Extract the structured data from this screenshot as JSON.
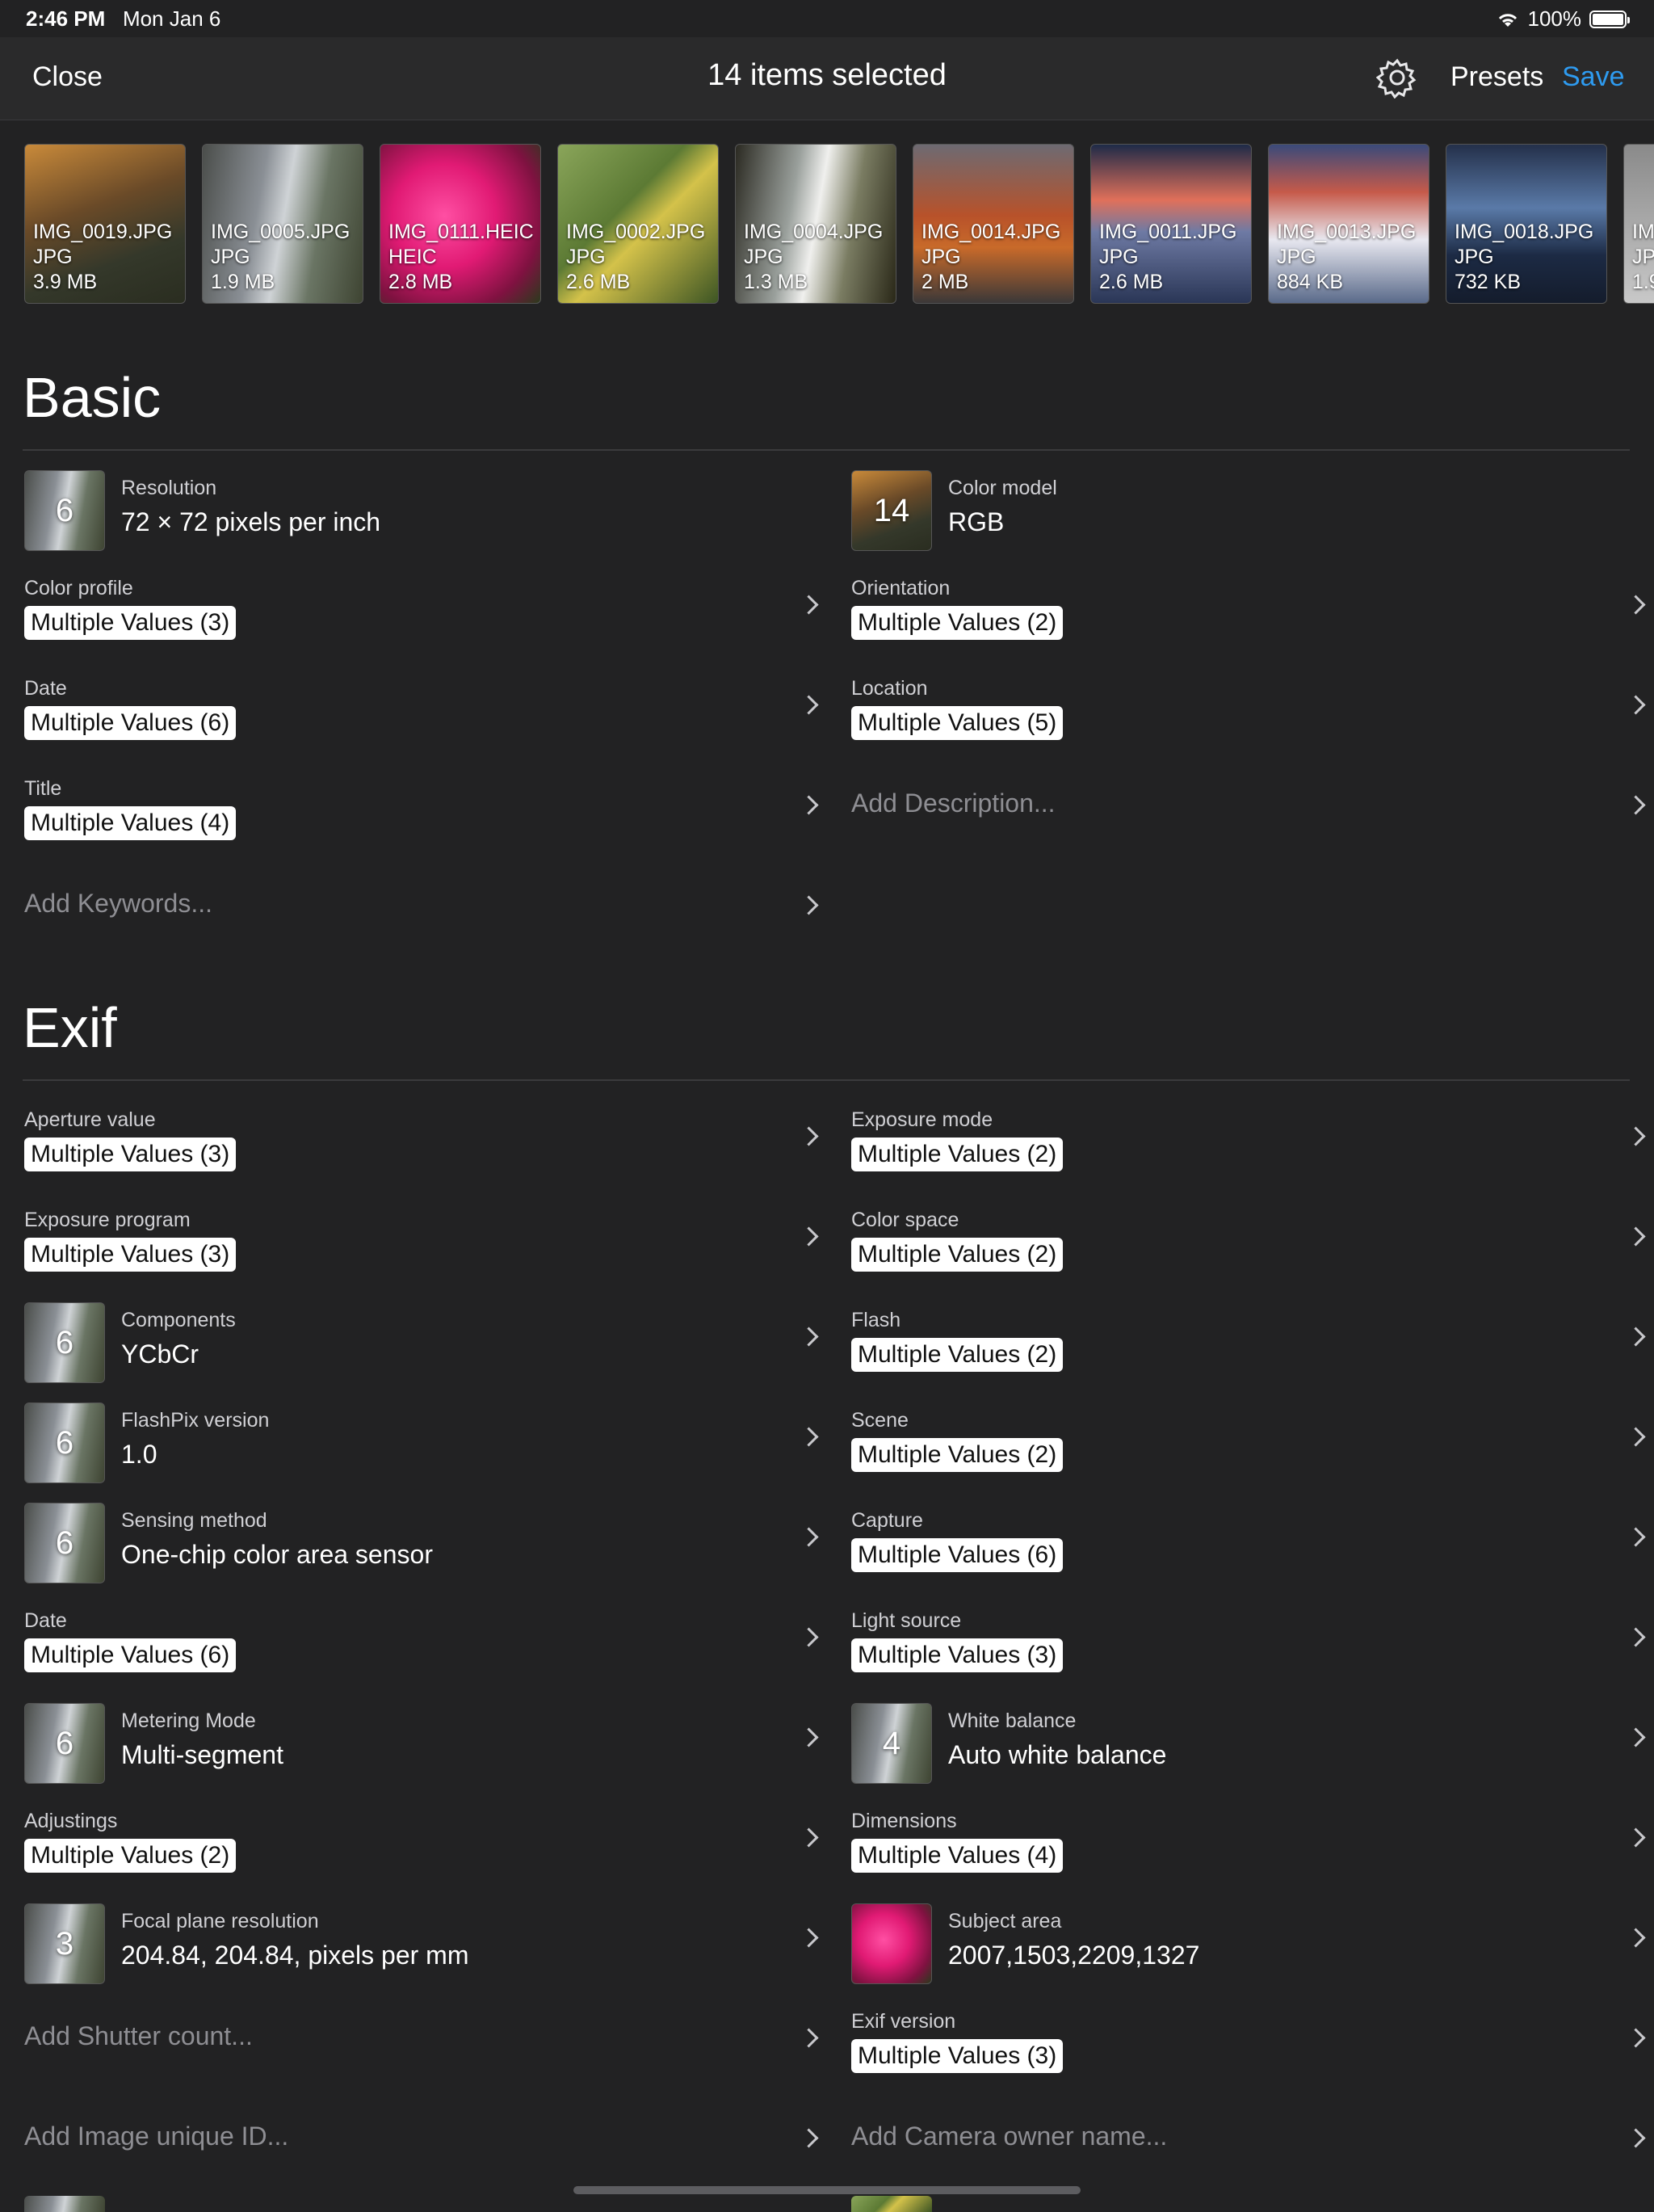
{
  "status": {
    "time": "2:46 PM",
    "date": "Mon Jan 6",
    "battery": "100%",
    "battery_level": 1.0,
    "wifi_icon": "wifi-icon"
  },
  "nav": {
    "close": "Close",
    "title": "14 items selected",
    "presets": "Presets",
    "save": "Save",
    "accent": "#2e9bf0",
    "settings_icon": "gear-icon"
  },
  "thumbs": [
    {
      "name": "IMG_0019.JPG",
      "type": "JPG",
      "size": "3.9 MB"
    },
    {
      "name": "IMG_0005.JPG",
      "type": "JPG",
      "size": "1.9 MB"
    },
    {
      "name": "IMG_0111.HEIC",
      "type": "HEIC",
      "size": "2.8 MB"
    },
    {
      "name": "IMG_0002.JPG",
      "type": "JPG",
      "size": "2.6 MB"
    },
    {
      "name": "IMG_0004.JPG",
      "type": "JPG",
      "size": "1.3 MB"
    },
    {
      "name": "IMG_0014.JPG",
      "type": "JPG",
      "size": "2 MB"
    },
    {
      "name": "IMG_0011.JPG",
      "type": "JPG",
      "size": "2.6 MB"
    },
    {
      "name": "IMG_0013.JPG",
      "type": "JPG",
      "size": "884 KB"
    },
    {
      "name": "IMG_0018.JPG",
      "type": "JPG",
      "size": "732 KB"
    },
    {
      "name": "IM",
      "type": "JP",
      "size": "1.9"
    }
  ],
  "sections": {
    "basic": "Basic",
    "exif": "Exif"
  },
  "basic": {
    "resolution": {
      "label": "Resolution",
      "value": "72 × 72 pixels per inch",
      "count": "6"
    },
    "color_model": {
      "label": "Color model",
      "value": "RGB",
      "count": "14"
    },
    "color_profile": {
      "label": "Color profile",
      "value": "Multiple Values (3)"
    },
    "orientation": {
      "label": "Orientation",
      "value": "Multiple Values (2)"
    },
    "date": {
      "label": "Date",
      "value": "Multiple Values (6)"
    },
    "location": {
      "label": "Location",
      "value": "Multiple Values (5)"
    },
    "title": {
      "label": "Title",
      "value": "Multiple Values (4)"
    },
    "description_placeholder": "Add Description...",
    "keywords_placeholder": "Add Keywords..."
  },
  "exif": {
    "aperture": {
      "label": "Aperture value",
      "value": "Multiple Values (3)"
    },
    "exposure_mode": {
      "label": "Exposure mode",
      "value": "Multiple Values (2)"
    },
    "exposure_program": {
      "label": "Exposure program",
      "value": "Multiple Values (3)"
    },
    "color_space": {
      "label": "Color space",
      "value": "Multiple Values (2)"
    },
    "components": {
      "label": "Components",
      "value": "YCbCr",
      "count": "6"
    },
    "flash": {
      "label": "Flash",
      "value": "Multiple Values (2)"
    },
    "flashpix": {
      "label": "FlashPix version",
      "value": "1.0",
      "count": "6"
    },
    "scene": {
      "label": "Scene",
      "value": "Multiple Values (2)"
    },
    "sensing": {
      "label": "Sensing method",
      "value": "One-chip color area sensor",
      "count": "6"
    },
    "capture": {
      "label": "Capture",
      "value": "Multiple Values (6)"
    },
    "date": {
      "label": "Date",
      "value": "Multiple Values (6)"
    },
    "light_source": {
      "label": "Light source",
      "value": "Multiple Values (3)"
    },
    "metering": {
      "label": "Metering Mode",
      "value": "Multi-segment",
      "count": "6"
    },
    "white_balance": {
      "label": "White balance",
      "value": "Auto white balance",
      "count": "4"
    },
    "adjustings": {
      "label": "Adjustings",
      "value": "Multiple Values (2)"
    },
    "dimensions": {
      "label": "Dimensions",
      "value": "Multiple Values (4)"
    },
    "focal_plane": {
      "label": "Focal plane resolution",
      "value": "204.84, 204.84, pixels per mm",
      "count": "3"
    },
    "subject_area": {
      "label": "Subject area",
      "value": "2007,1503,2209,1327"
    },
    "shutter_placeholder": "Add Shutter count...",
    "exif_version": {
      "label": "Exif version",
      "value": "Multiple Values (3)"
    },
    "unique_id_placeholder": "Add Image unique ID...",
    "owner_placeholder": "Add Camera owner name..."
  }
}
